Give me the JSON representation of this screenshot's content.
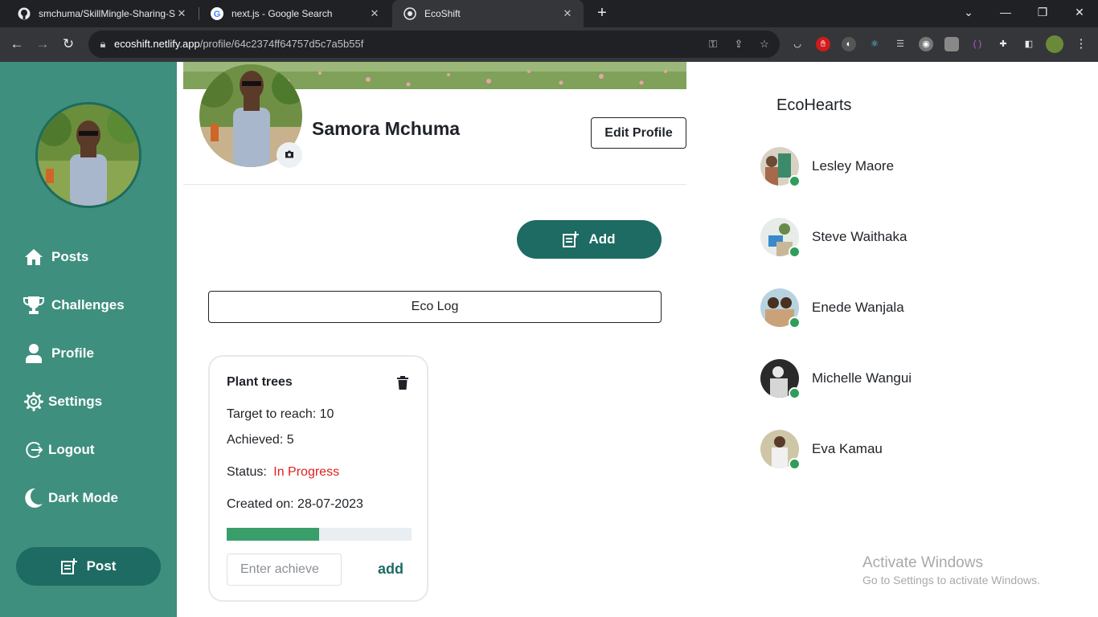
{
  "browser": {
    "tabs": [
      {
        "title": "smchuma/SkillMingle-Sharing-S",
        "favicon": "github-icon",
        "active": false
      },
      {
        "title": "next.js - Google Search",
        "favicon": "google-icon",
        "active": false
      },
      {
        "title": "EcoShift",
        "favicon": "ecoshift-icon",
        "active": true
      }
    ],
    "url_host": "ecoshift.netlify.app",
    "url_path": "/profile/64c2374ff64757d5c7a5b55f"
  },
  "sidebar": {
    "items": [
      {
        "label": "Posts",
        "icon": "home-icon"
      },
      {
        "label": "Challenges",
        "icon": "trophy-icon"
      },
      {
        "label": "Profile",
        "icon": "user-icon"
      },
      {
        "label": "Settings",
        "icon": "gear-icon"
      },
      {
        "label": "Logout",
        "icon": "logout-icon"
      },
      {
        "label": "Dark Mode",
        "icon": "moon-icon"
      }
    ],
    "post_label": "Post"
  },
  "profile": {
    "name": "Samora Mchuma",
    "edit_label": "Edit Profile"
  },
  "main": {
    "add_label": "Add",
    "eco_log_label": "Eco Log"
  },
  "eco_log_card": {
    "title": "Plant trees",
    "target": "Target to reach: 10",
    "achieved": "Achieved: 5",
    "status_label": "Status:",
    "status_value": "In Progress",
    "created": "Created on: 28-07-2023",
    "progress_fraction": 0.5,
    "input_placeholder": "Enter achieve",
    "add_link": "add"
  },
  "ecohearts": {
    "title": "EcoHearts",
    "friends": [
      {
        "name": "Lesley Maore",
        "online": true
      },
      {
        "name": "Steve Waithaka",
        "online": true
      },
      {
        "name": "Enede Wanjala",
        "online": true
      },
      {
        "name": "Michelle Wangui",
        "online": true
      },
      {
        "name": "Eva Kamau",
        "online": true
      }
    ]
  },
  "watermark": {
    "line1": "Activate Windows",
    "line2": "Go to Settings to activate Windows."
  },
  "colors": {
    "sidebar": "#3e8f7e",
    "primary_button": "#1d6b63",
    "status_in_progress": "#e01e1e",
    "progress": "#3a9e6a",
    "online": "#2f9e5a"
  }
}
